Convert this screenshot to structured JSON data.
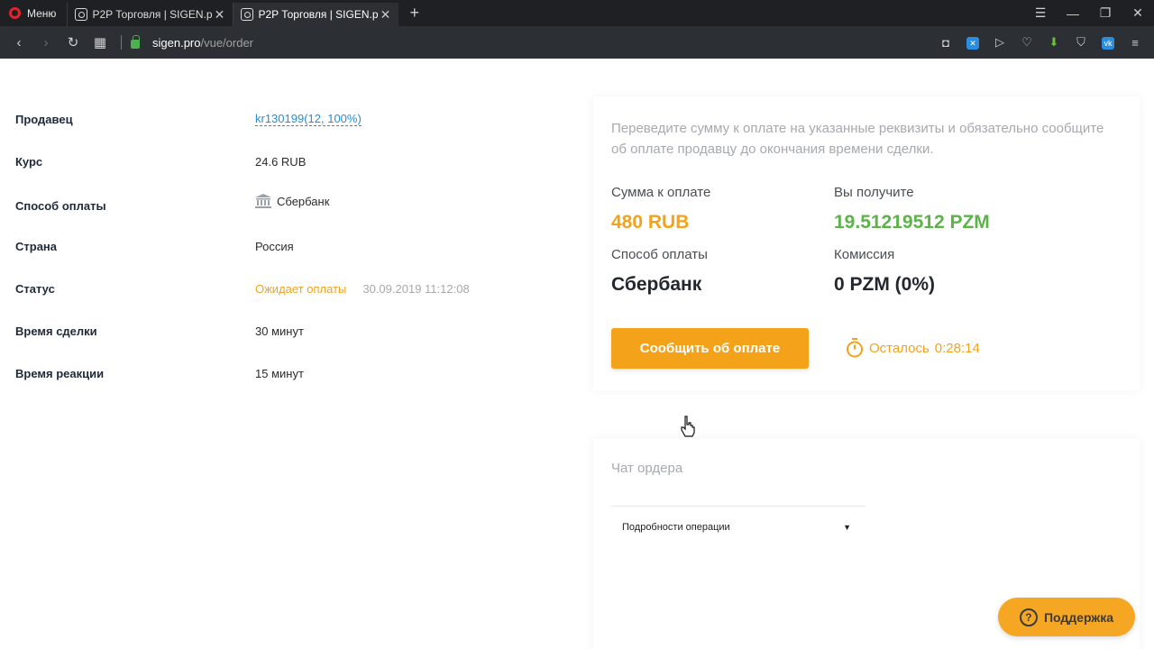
{
  "browser": {
    "menu_label": "Меню",
    "tabs": [
      {
        "title": "P2P Торговля | SIGEN.pro",
        "active": false
      },
      {
        "title": "P2P Торговля | SIGEN.pro",
        "active": true
      }
    ],
    "url_host": "sigen.pro",
    "url_path": "/vue/order"
  },
  "order": {
    "rows": [
      {
        "label": "Продавец",
        "value": "kr130199(12, 100%)"
      },
      {
        "label": "Курс",
        "value": "24.6 RUB"
      },
      {
        "label": "Способ оплаты",
        "value": "Сбербанк"
      },
      {
        "label": "Страна",
        "value": "Россия"
      },
      {
        "label": "Статус",
        "value": "Ожидает оплаты",
        "date": "30.09.2019 11:12:08"
      },
      {
        "label": "Время сделки",
        "value": "30 минут"
      },
      {
        "label": "Время реакции",
        "value": "15 минут"
      }
    ]
  },
  "payment": {
    "hint": "Переведите сумму к оплате на указанные реквизиты и обязательно сообщите об оплате продавцу до окончания времени сделки.",
    "amount_label": "Сумма к оплате",
    "amount": "480 RUB",
    "receive_label": "Вы получите",
    "receive": "19.51219512 PZM",
    "method_label": "Способ оплаты",
    "method": "Сбербанк",
    "fee_label": "Комиссия",
    "fee": "0 PZM (0%)",
    "button": "Сообщить об оплате",
    "timer_label": "Осталось",
    "timer_value": "0:28:14"
  },
  "chat": {
    "title": "Чат ордера",
    "details": "Подробности операции"
  },
  "support": {
    "label": "Поддержка"
  },
  "colors": {
    "accent": "#f5a21b",
    "green": "#5db24a",
    "link": "#2a8ccf"
  }
}
